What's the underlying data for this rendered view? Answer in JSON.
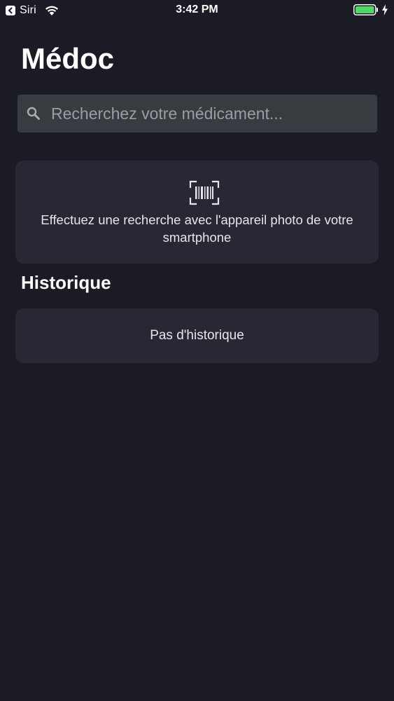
{
  "status_bar": {
    "carrier": "Siri",
    "time": "3:42 PM",
    "battery_color": "#4cd964"
  },
  "header": {
    "title": "Médoc"
  },
  "search": {
    "placeholder": "Recherchez votre médicament...",
    "value": ""
  },
  "scan": {
    "icon": "barcode-scan-icon",
    "text": "Effectuez une recherche avec l'appareil photo de votre smartphone"
  },
  "history": {
    "title": "Historique",
    "empty_text": "Pas d'historique"
  },
  "colors": {
    "background": "#1a1b25",
    "card": "#272834",
    "search_field": "#383b40"
  }
}
